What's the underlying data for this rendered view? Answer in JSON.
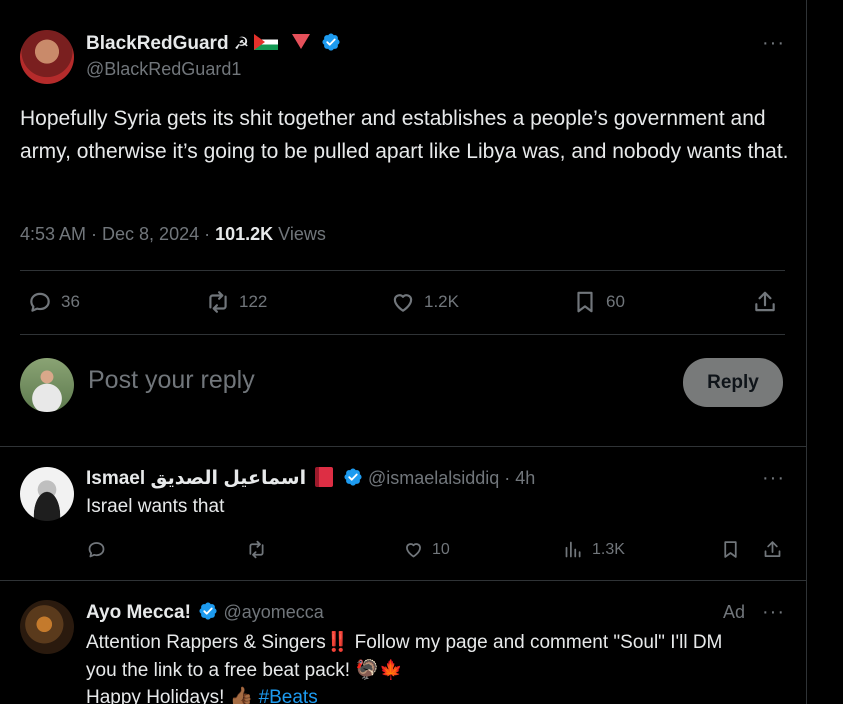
{
  "main_tweet": {
    "display_name": "BlackRedGuard",
    "name_emojis": "☭",
    "handle": "@BlackRedGuard1",
    "text": "Hopefully Syria gets its shit together and establishes a people’s government and army, otherwise it’s going to be pulled apart like Libya was, and nobody wants that.",
    "time": "4:53 AM · Dec 8, 2024 · ",
    "views_count": "101.2K",
    "views_label": " Views",
    "replies": "36",
    "reposts": "122",
    "likes": "1.2K",
    "bookmarks": "60"
  },
  "composer": {
    "placeholder": "Post your reply",
    "button_label": "Reply"
  },
  "replies": [
    {
      "display_name": "Ismael اسماعيل الصديق",
      "handle": "@ismaelalsiddiq",
      "time": " · 4h",
      "text": "Israel wants that",
      "replies": "",
      "reposts": "",
      "likes": "10",
      "views": "1.3K"
    },
    {
      "display_name": "Ayo Mecca!",
      "handle": "@ayomecca",
      "ad_label": "Ad",
      "text_line1": "Attention Rappers & Singers‼️ Follow my page and comment \"Soul\" I'll DM",
      "text_line2": "you the link to a free beat pack! 🦃🍁",
      "text_line3": "Happy Holidays! 👍🏾 ",
      "hashtag": "#Beats"
    }
  ],
  "more_label": "···",
  "colors": {
    "accent": "#1d9bf0",
    "text": "#e7e9ea",
    "muted": "#71767b",
    "border": "#2f3336"
  }
}
